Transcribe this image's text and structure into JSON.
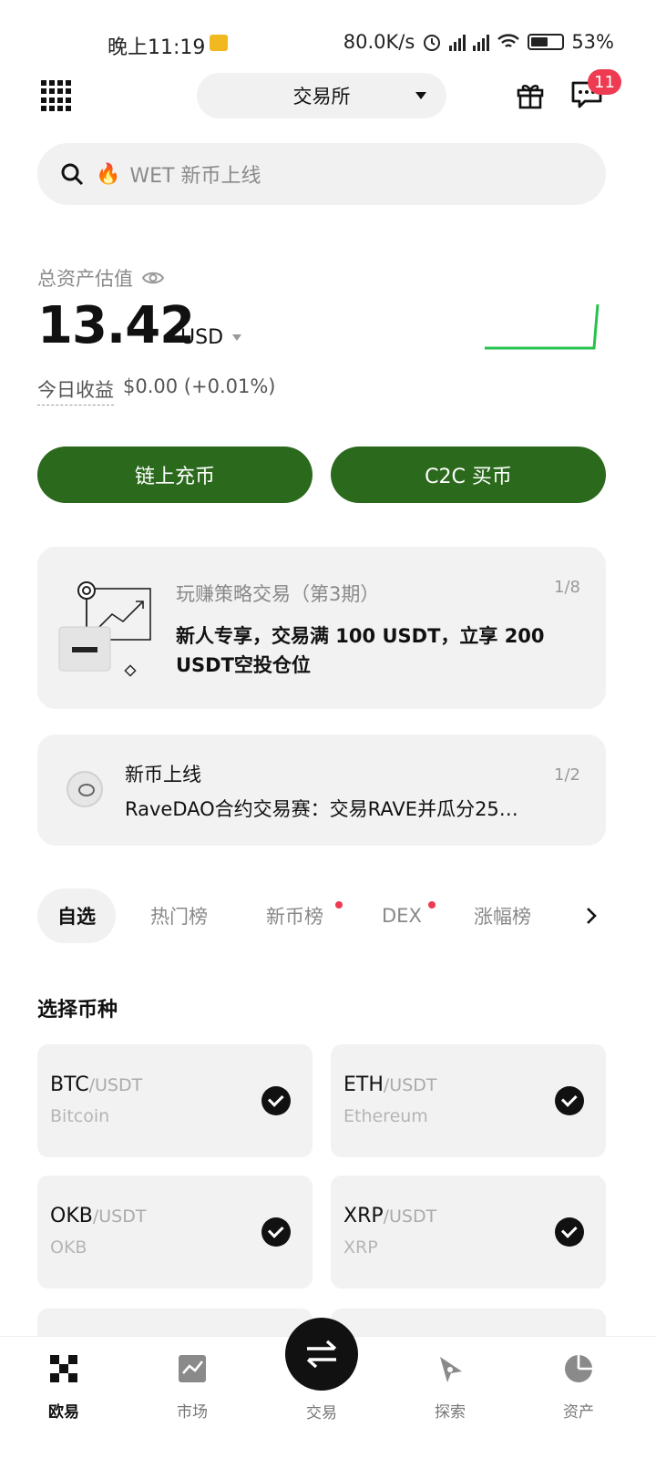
{
  "status_bar": {
    "time": "晚上11:19",
    "net_speed": "80.0K/s",
    "battery": "53%"
  },
  "header": {
    "mode_label": "交易所",
    "notification_count": "11"
  },
  "search": {
    "placeholder": "WET 新币上线"
  },
  "assets": {
    "label": "总资产估值",
    "amount": "13.42",
    "currency": "USD",
    "today_pnl_label": "今日收益",
    "today_pnl_value": "$0.00 (+0.01%)",
    "sparkline_color": "#27c24c"
  },
  "actions": {
    "deposit_label": "链上充币",
    "c2c_label": "C2C 买币",
    "button_color": "#2b6a1c"
  },
  "promo_card": {
    "title": "玩赚策略交易（第3期）",
    "body": "新人专享，交易满 100 USDT，立享 200 USDT空投仓位",
    "pager": "1/8"
  },
  "news_card": {
    "title": "新币上线",
    "body": "RaveDAO合约交易赛：交易RAVE并瓜分25…",
    "pager": "1/2"
  },
  "tabs": [
    {
      "label": "自选",
      "active": true
    },
    {
      "label": "热门榜"
    },
    {
      "label": "新币榜",
      "dot": true
    },
    {
      "label": "DEX",
      "dot": true
    },
    {
      "label": "涨幅榜"
    }
  ],
  "section_title": "选择币种",
  "coins": [
    {
      "symbol": "BTC",
      "quote": "/USDT",
      "name": "Bitcoin"
    },
    {
      "symbol": "ETH",
      "quote": "/USDT",
      "name": "Ethereum"
    },
    {
      "symbol": "OKB",
      "quote": "/USDT",
      "name": "OKB"
    },
    {
      "symbol": "XRP",
      "quote": "/USDT",
      "name": "XRP"
    }
  ],
  "nav": {
    "home": "欧易",
    "market": "市场",
    "trade": "交易",
    "explore": "探索",
    "assets": "资产"
  }
}
